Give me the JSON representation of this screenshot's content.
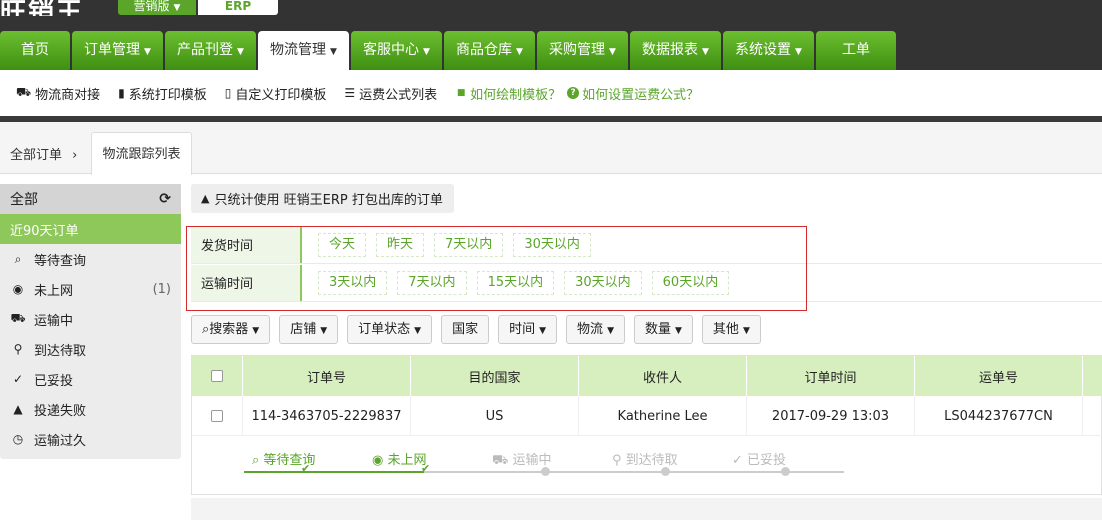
{
  "brand": {
    "logo": "旺销王",
    "edition": "营销版",
    "product": "ERP"
  },
  "nav": [
    {
      "label": "首页",
      "caret": false
    },
    {
      "label": "订单管理",
      "caret": true
    },
    {
      "label": "产品刊登",
      "caret": true
    },
    {
      "label": "物流管理",
      "caret": true,
      "active": true
    },
    {
      "label": "客服中心",
      "caret": true
    },
    {
      "label": "商品仓库",
      "caret": true
    },
    {
      "label": "采购管理",
      "caret": true
    },
    {
      "label": "数据报表",
      "caret": true
    },
    {
      "label": "系统设置",
      "caret": true
    },
    {
      "label": "工单",
      "caret": false
    }
  ],
  "subnav": {
    "items": [
      {
        "label": "物流商对接",
        "icon": "truck-icon",
        "glyph": "⛟"
      },
      {
        "label": "系统打印模板",
        "icon": "bookmark-icon",
        "glyph": "▮"
      },
      {
        "label": "自定义打印模板",
        "icon": "bookmark-outline-icon",
        "glyph": "▯"
      },
      {
        "label": "运费公式列表",
        "icon": "list-icon",
        "glyph": "☰"
      }
    ],
    "help": [
      {
        "label": "如何绘制模板？",
        "icon": "video-icon",
        "glyph": "■"
      },
      {
        "label": "如何设置运费公式？",
        "icon": "question-circle-icon",
        "glyph": "?"
      }
    ]
  },
  "breadcrumb": {
    "root": "全部订单",
    "arrow": "›",
    "current_tab": "物流跟踪列表"
  },
  "sidebar": {
    "header": "全部",
    "items": [
      {
        "label": "近90天订单",
        "icon": "",
        "glyph": "",
        "active": true,
        "count": ""
      },
      {
        "label": "等待查询",
        "icon": "search-icon",
        "glyph": "⌕",
        "count": ""
      },
      {
        "label": "未上网",
        "icon": "eye-slash-icon",
        "glyph": "◉",
        "count": "(1)"
      },
      {
        "label": "运输中",
        "icon": "truck-icon",
        "glyph": "⛟",
        "count": ""
      },
      {
        "label": "到达待取",
        "icon": "map-marker-icon",
        "glyph": "⚲",
        "count": ""
      },
      {
        "label": "已妥投",
        "icon": "check-circle-icon",
        "glyph": "✓",
        "count": ""
      },
      {
        "label": "投递失败",
        "icon": "warning-icon",
        "glyph": "▲",
        "count": ""
      },
      {
        "label": "运输过久",
        "icon": "clock-icon",
        "glyph": "◷",
        "count": ""
      }
    ]
  },
  "notice": "只统计使用 旺销王ERP 打包出库的订单",
  "filters": {
    "ship_time": {
      "label": "发货时间",
      "options": [
        "今天",
        "昨天",
        "7天以内",
        "30天以内"
      ]
    },
    "transit_time": {
      "label": "运输时间",
      "options": [
        "3天以内",
        "7天以内",
        "15天以内",
        "30天以内",
        "60天以内"
      ]
    }
  },
  "toolbar": [
    {
      "label": "搜索器",
      "icon": "search-icon",
      "caret": true
    },
    {
      "label": "店铺",
      "caret": true
    },
    {
      "label": "订单状态",
      "caret": true
    },
    {
      "label": "国家",
      "caret": false
    },
    {
      "label": "时间",
      "caret": true
    },
    {
      "label": "物流",
      "caret": true
    },
    {
      "label": "数量",
      "caret": true
    },
    {
      "label": "其他",
      "caret": true
    }
  ],
  "table": {
    "headers": [
      "订单号",
      "目的国家",
      "收件人",
      "订单时间",
      "运单号"
    ],
    "rows": [
      {
        "order_no": "114-3463705-2229837",
        "country": "US",
        "recipient": "Katherine Lee",
        "time": "2017-09-29 13:03",
        "tracking": "LS044237677CN"
      }
    ],
    "tracker": [
      {
        "label": "等待查询",
        "icon": "search-icon",
        "done": true
      },
      {
        "label": "未上网",
        "icon": "eye-slash-icon",
        "done": true
      },
      {
        "label": "运输中",
        "icon": "truck-icon",
        "done": false
      },
      {
        "label": "到达待取",
        "icon": "map-marker-icon",
        "done": false
      },
      {
        "label": "已妥投",
        "icon": "check-circle-icon",
        "done": false
      }
    ]
  },
  "colors": {
    "green": "#5aa52a",
    "light_green": "#8fc85a",
    "header_green": "#d7eebe",
    "dark": "#333333",
    "red": "#d32b2b"
  }
}
